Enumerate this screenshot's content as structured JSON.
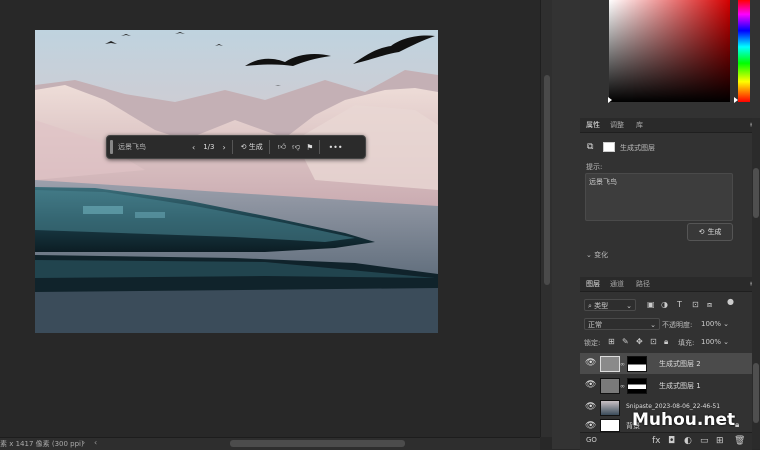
{
  "status_bar": {
    "text": "素 x 1417 像素 (300 ppi)"
  },
  "gen_toolbar": {
    "prompt": "远景飞鸟",
    "counter": "1/3",
    "generate_label": "生成",
    "prev_icon": "chevron-left-icon",
    "next_icon": "chevron-right-icon"
  },
  "properties_panel": {
    "tabs": [
      "属性",
      "调整",
      "库"
    ],
    "layer_type": "生成式图层",
    "prompt_label": "提示:",
    "prompt_value": "远景飞鸟",
    "generate_button": "生成",
    "variations_label": "变化"
  },
  "layers_panel": {
    "tabs": [
      "图层",
      "通道",
      "路径"
    ],
    "filter_type": "类型",
    "blend_mode": "正常",
    "opacity_label": "不透明度:",
    "opacity_value": "100%",
    "lock_label": "锁定:",
    "fill_label": "填充:",
    "fill_value": "100%",
    "layers": [
      {
        "name": "生成式图层 2",
        "selected": true
      },
      {
        "name": "生成式图层 1",
        "selected": false
      },
      {
        "name": "Snipaste_2023-08-06_22-46-51",
        "selected": false
      },
      {
        "name": "背景",
        "selected": false
      }
    ]
  },
  "watermark": {
    "text": "Muhou.net"
  },
  "colors": {
    "accent": "#4b4b4b",
    "panel": "#323232",
    "canvas_bg": "#282828"
  }
}
